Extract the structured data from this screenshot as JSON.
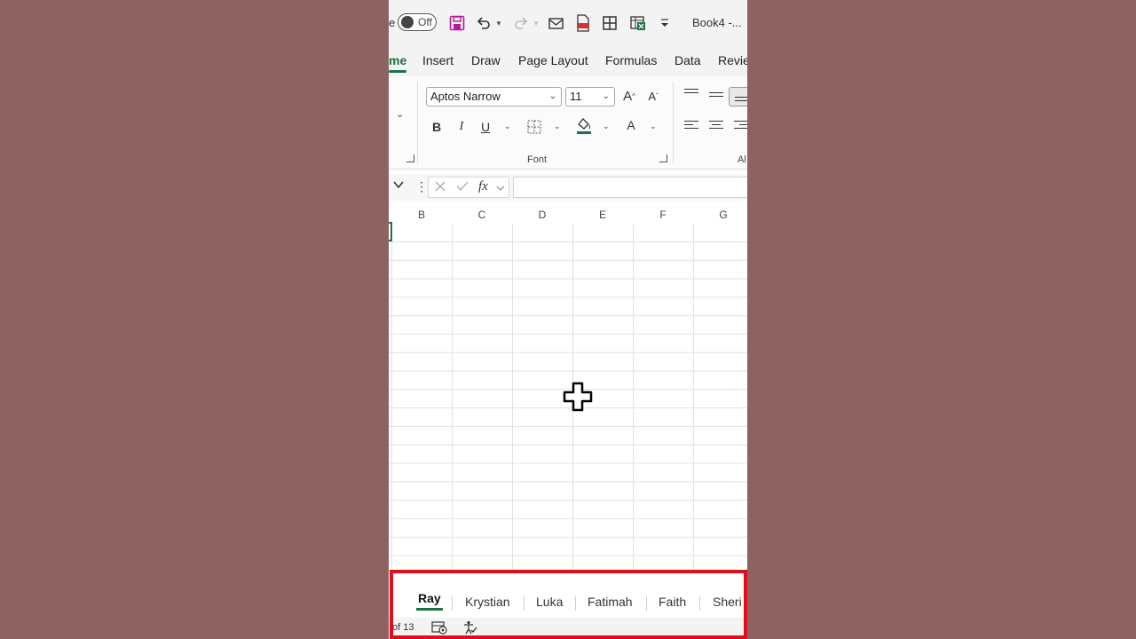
{
  "qat": {
    "autosave_state": "Off",
    "doc_title": "Book4 -..."
  },
  "tabs": [
    {
      "label": "me"
    },
    {
      "label": "Insert"
    },
    {
      "label": "Draw"
    },
    {
      "label": "Page Layout"
    },
    {
      "label": "Formulas"
    },
    {
      "label": "Data"
    },
    {
      "label": "Revie"
    }
  ],
  "ribbon": {
    "font_name": "Aptos Narrow",
    "font_size": "11",
    "bold": "B",
    "italic": "I",
    "underline": "U",
    "font_color": "A",
    "font_group_label": "Font",
    "alignment_group_label": "Al"
  },
  "formula_bar": {
    "fx": "fx",
    "value": ""
  },
  "grid": {
    "columns": [
      "B",
      "C",
      "D",
      "E",
      "F",
      "G"
    ]
  },
  "sheets": {
    "tabs": [
      "Ray",
      "Krystian",
      "Luka",
      "Fatimah",
      "Faith",
      "Sheri"
    ],
    "active": "Ray"
  },
  "status": {
    "sheet_count": "of 13"
  },
  "colors": {
    "accent": "#1e7145",
    "highlight_box": "#e00d1b",
    "background": "#8f6262"
  }
}
